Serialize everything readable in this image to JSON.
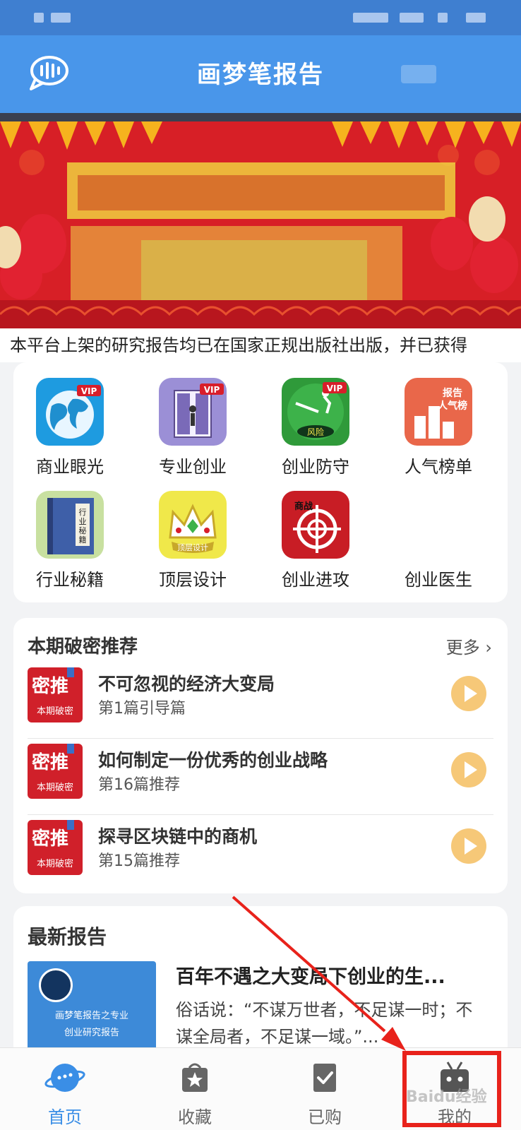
{
  "header": {
    "title": "画梦笔报告",
    "chat_icon": "chat-bubble-icon"
  },
  "banner": {
    "bg_color": "#d71f26"
  },
  "notice": {
    "text": "本平台上架的研究报告均已在国家正规出版社出版，并已获得"
  },
  "grid": {
    "items": [
      {
        "label": "商业眼光",
        "icon": "globe-vip-icon"
      },
      {
        "label": "专业创业",
        "icon": "door-vip-icon"
      },
      {
        "label": "创业防守",
        "icon": "risk-vip-icon"
      },
      {
        "label": "人气榜单",
        "icon": "ranking-icon"
      },
      {
        "label": "行业秘籍",
        "icon": "book-icon"
      },
      {
        "label": "顶层设计",
        "icon": "crown-icon"
      },
      {
        "label": "创业进攻",
        "icon": "target-icon"
      },
      {
        "label": "创业医生",
        "icon": "doctor-icon"
      }
    ]
  },
  "recommend": {
    "title": "本期破密推荐",
    "more": "更多 ›",
    "thumb_big": "密推",
    "thumb_small": "本期破密",
    "items": [
      {
        "title": "不可忽视的经济大变局",
        "sub": "第1篇引导篇"
      },
      {
        "title": "如何制定一份优秀的创业战略",
        "sub": "第16篇推荐"
      },
      {
        "title": "探寻区块链中的商机",
        "sub": "第15篇推荐"
      }
    ]
  },
  "latest": {
    "title": "最新报告",
    "report_title": "百年不遇之大变局下创业的生...",
    "report_desc": "俗话说：“不谋万世者，不足谋一时；不谋全局者，不足谋一域。”...",
    "thumb_caption_1": "画梦笔报告之专业",
    "thumb_caption_2": "创业研究报告"
  },
  "nav": {
    "items": [
      {
        "label": "首页",
        "icon": "planet-icon"
      },
      {
        "label": "收藏",
        "icon": "star-bag-icon"
      },
      {
        "label": "已购",
        "icon": "check-doc-icon"
      },
      {
        "label": "我的",
        "icon": "tv-robot-icon"
      }
    ]
  },
  "colors": {
    "header": "#4996ea",
    "accent": "#3a8ee6",
    "highlight": "#e8221b",
    "play": "#f6c878"
  },
  "watermark": "Baidu经验"
}
